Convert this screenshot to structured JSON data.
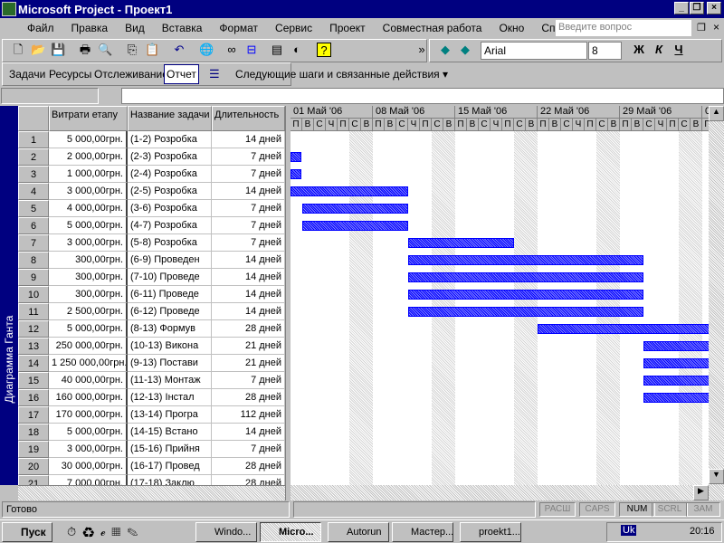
{
  "window": {
    "title": "Microsoft Project - Проект1"
  },
  "menu": [
    "Файл",
    "Правка",
    "Вид",
    "Вставка",
    "Формат",
    "Сервис",
    "Проект",
    "Совместная работа",
    "Окно",
    "Справка"
  ],
  "ask_placeholder": "Введите вопрос",
  "font": {
    "name": "Arial",
    "size": "8",
    "bold": "Ж",
    "italic": "К",
    "underline": "Ч"
  },
  "guide_toolbar": {
    "items": [
      "Задачи",
      "Ресурсы",
      "Отслеживание",
      "Отчет"
    ],
    "next_steps": "Следующие шаги и связанные действия ▾"
  },
  "view_label": "Диаграмма Ганта",
  "table": {
    "columns": [
      "Витрати етапу",
      "Название задачи",
      "Длительность"
    ],
    "rows": [
      [
        "1",
        "5 000,00грн.",
        "(1-2) Розробка",
        "14 дней"
      ],
      [
        "2",
        "2 000,00грн.",
        "(2-3) Розробка",
        "7 дней"
      ],
      [
        "3",
        "1 000,00грн.",
        "(2-4) Розробка",
        "7 дней"
      ],
      [
        "4",
        "3 000,00грн.",
        "(2-5) Розробка",
        "14 дней"
      ],
      [
        "5",
        "4 000,00грн.",
        "(3-6) Розробка",
        "7 дней"
      ],
      [
        "6",
        "5 000,00грн.",
        "(4-7) Розробка",
        "7 дней"
      ],
      [
        "7",
        "3 000,00грн.",
        "(5-8) Розробка",
        "7 дней"
      ],
      [
        "8",
        "300,00грн.",
        "(6-9) Проведен",
        "14 дней"
      ],
      [
        "9",
        "300,00грн.",
        "(7-10) Проведе",
        "14 дней"
      ],
      [
        "10",
        "300,00грн.",
        "(6-11) Проведе",
        "14 дней"
      ],
      [
        "11",
        "2 500,00грн.",
        "(6-12) Проведе",
        "14 дней"
      ],
      [
        "12",
        "5 000,00грн.",
        "(8-13) Формув",
        "28 дней"
      ],
      [
        "13",
        "250 000,00грн.",
        "(10-13) Викона",
        "21 дней"
      ],
      [
        "14",
        "1 250 000,00грн.",
        "(9-13) Постави",
        "21 дней"
      ],
      [
        "15",
        "40 000,00грн.",
        "(11-13) Монтаж",
        "7 дней"
      ],
      [
        "16",
        "160 000,00грн.",
        "(12-13) Інстал",
        "28 дней"
      ],
      [
        "17",
        "170 000,00грн.",
        "(13-14) Програ",
        "112 дней"
      ],
      [
        "18",
        "5 000,00грн.",
        "(14-15) Встано",
        "14 дней"
      ],
      [
        "19",
        "3 000,00грн.",
        "(15-16) Прийня",
        "7 дней"
      ],
      [
        "20",
        "30 000,00грн.",
        "(16-17) Провед",
        "28 дней"
      ],
      [
        "21",
        "7 000,00грн.",
        "(17-18) Заклю",
        "28 дней"
      ]
    ]
  },
  "gantt": {
    "weeks": [
      "01 Май '06",
      "08 Май '06",
      "15 Май '06",
      "22 Май '06",
      "29 Май '06",
      "0"
    ],
    "days": [
      "П",
      "В",
      "С",
      "Ч",
      "П",
      "С",
      "В"
    ],
    "bars_days": [
      null,
      [
        0,
        0.9
      ],
      [
        0,
        0.9
      ],
      [
        0,
        10
      ],
      [
        1,
        10
      ],
      [
        1,
        10
      ],
      [
        10,
        19
      ],
      [
        10,
        30
      ],
      [
        10,
        30
      ],
      [
        10,
        30
      ],
      [
        10,
        30
      ],
      [
        21,
        40
      ],
      [
        30,
        40
      ],
      [
        30,
        40
      ],
      [
        30,
        40
      ],
      [
        30,
        40
      ]
    ],
    "color": "#0000ff"
  },
  "status": {
    "text": "Готово",
    "indicators": [
      "РАСШ",
      "CAPS",
      "NUM",
      "SCRL",
      "ЗАМ"
    ]
  },
  "taskbar": {
    "start": "Пуск",
    "tasks": [
      "Windo...",
      "Micro...",
      "Autorun",
      "Мастер...",
      "proekt1..."
    ],
    "lang": "Uk",
    "clock": "20:16"
  }
}
